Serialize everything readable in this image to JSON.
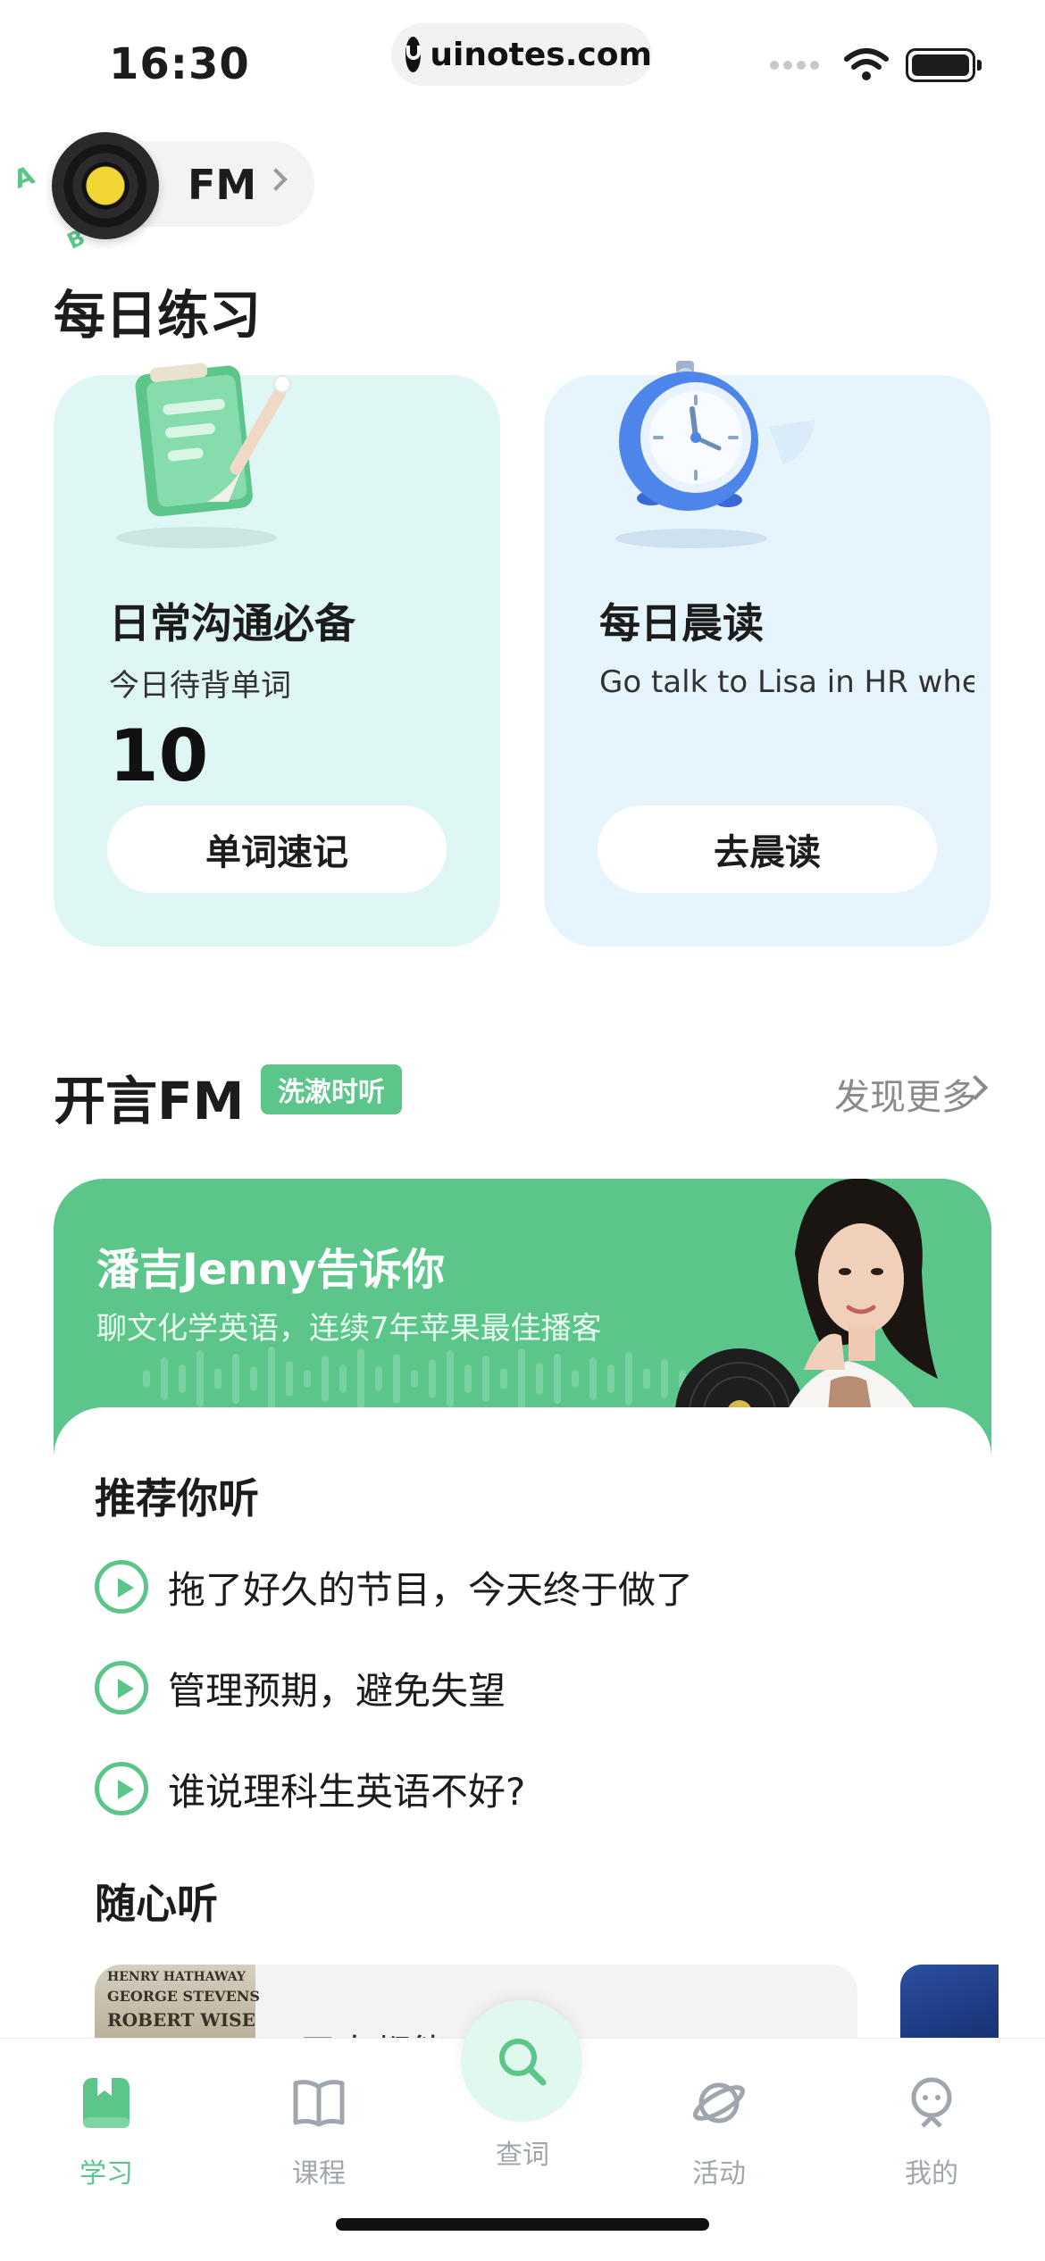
{
  "status_bar": {
    "time": "16:30",
    "url": "uinotes.com"
  },
  "fm_entry": {
    "label": "FM",
    "badge_letters": [
      "A",
      "B"
    ]
  },
  "daily_practice": {
    "title": "每日练习",
    "cards": [
      {
        "title": "日常沟通必备",
        "subtitle": "今日待背单词",
        "count": "10",
        "button": "单词速记",
        "icon": "clipboard-icon",
        "bg": "#def6f4"
      },
      {
        "title": "每日晨读",
        "subtitle": "Go talk to Lisa in HR when you have a seco...",
        "button": "去晨读",
        "icon": "alarm-clock-icon",
        "bg": "#e6f4fd"
      }
    ]
  },
  "fm_section": {
    "title": "开言FM",
    "badge": "洗漱时听",
    "more": "发现更多",
    "banner": {
      "title": "潘吉Jenny告诉你",
      "subtitle": "聊文化学英语，连续7年苹果最佳播客",
      "bg": "#5cc68a"
    },
    "recommend": {
      "title": "推荐你听",
      "items": [
        "拖了好久的节目，今天终于做了",
        "管理预期，避免失望",
        "谁说理科生英语不好?"
      ]
    },
    "random": {
      "title": "随心听",
      "item_text": "用人都能",
      "cover_lines": [
        "HENRY HATHAWAY",
        "GEORGE STEVENS",
        "ROBERT WISE"
      ]
    }
  },
  "tabbar": {
    "tabs": [
      {
        "label": "学习",
        "icon": "book-icon",
        "active": true
      },
      {
        "label": "课程",
        "icon": "open-book-icon",
        "active": false
      },
      {
        "label": "查词",
        "icon": "search-icon",
        "active": false
      },
      {
        "label": "活动",
        "icon": "planet-icon",
        "active": false
      },
      {
        "label": "我的",
        "icon": "profile-icon",
        "active": false
      }
    ]
  },
  "colors": {
    "accent": "#5cc68a",
    "text": "#1c1c1c",
    "muted": "#a0a6ad"
  }
}
